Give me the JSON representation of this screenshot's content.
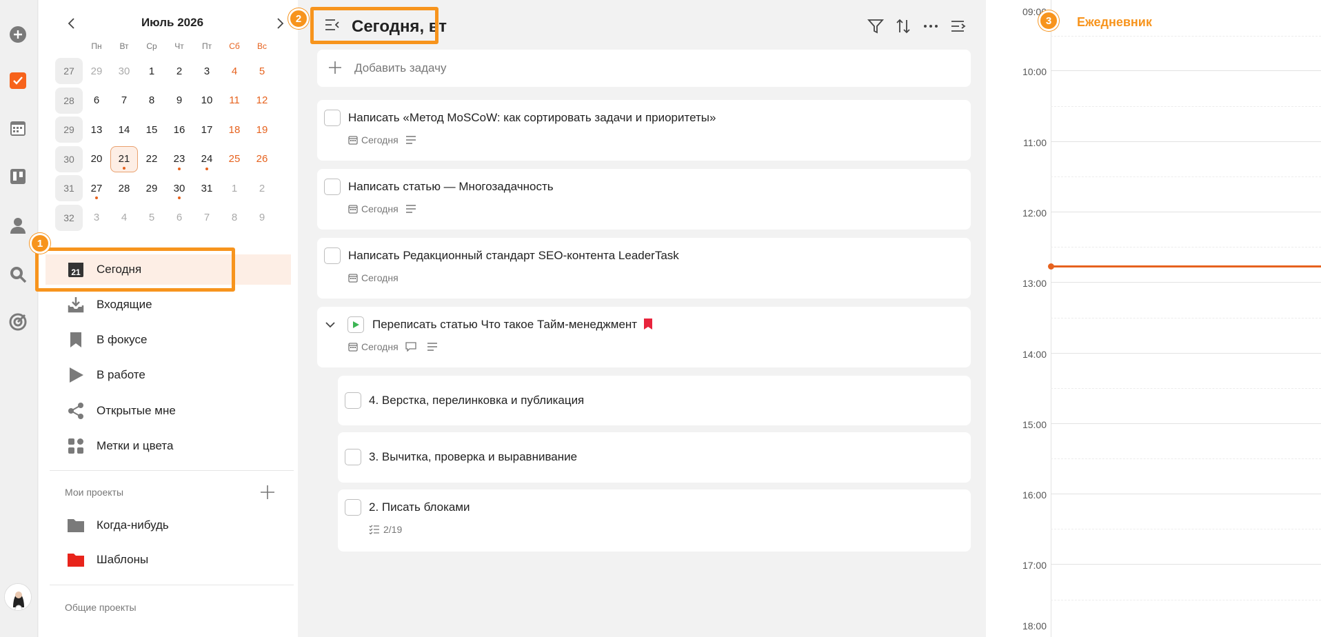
{
  "calendar": {
    "title": "Июль 2026",
    "dow": [
      "Пн",
      "Вт",
      "Ср",
      "Чт",
      "Пт",
      "Сб",
      "Вс"
    ],
    "weeks": [
      {
        "wk": "27",
        "days": [
          "29",
          "30",
          "1",
          "2",
          "3",
          "4",
          "5"
        ]
      },
      {
        "wk": "28",
        "days": [
          "6",
          "7",
          "8",
          "9",
          "10",
          "11",
          "12"
        ]
      },
      {
        "wk": "29",
        "days": [
          "13",
          "14",
          "15",
          "16",
          "17",
          "18",
          "19"
        ]
      },
      {
        "wk": "30",
        "days": [
          "20",
          "21",
          "22",
          "23",
          "24",
          "25",
          "26"
        ]
      },
      {
        "wk": "31",
        "days": [
          "27",
          "28",
          "29",
          "30",
          "31",
          "1",
          "2"
        ]
      },
      {
        "wk": "32",
        "days": [
          "3",
          "4",
          "5",
          "6",
          "7",
          "8",
          "9"
        ]
      }
    ]
  },
  "nav": {
    "today": "Сегодня",
    "today_icon_num": "21",
    "inbox": "Входящие",
    "focus": "В фокусе",
    "in_work": "В работе",
    "shared": "Открытые мне",
    "tags": "Метки и цвета"
  },
  "projects": {
    "my_label": "Мои проекты",
    "items": [
      "Когда-нибудь",
      "Шаблоны"
    ],
    "common_label": "Общие проекты"
  },
  "badges": {
    "one": "1",
    "two": "2",
    "three": "3"
  },
  "main": {
    "title": "Сегодня, вт",
    "add_task": "Добавить задачу",
    "tasks": [
      {
        "title": "Написать «Метод MoSCoW: как сортировать задачи и приоритеты»",
        "date": "Сегодня"
      },
      {
        "title": "Написать статью — Многозадачность",
        "date": "Сегодня"
      },
      {
        "title": "Написать Редакционный стандарт SEO-контента LeaderTask",
        "date": "Сегодня"
      },
      {
        "title": "Переписать статью Что такое Тайм-менеджмент",
        "date": "Сегодня"
      }
    ],
    "subtasks": [
      {
        "title": "4. Верстка, перелинковка и публикация"
      },
      {
        "title": "3. Вычитка, проверка и выравнивание"
      },
      {
        "title": "2. Писать блоками",
        "progress": "2/19"
      }
    ]
  },
  "timeline": {
    "title": "Ежедневник",
    "hours": [
      "09:00",
      "10:00",
      "11:00",
      "12:00",
      "13:00",
      "14:00",
      "15:00",
      "16:00",
      "17:00",
      "18:00"
    ]
  },
  "colors": {
    "accent": "#f7941d",
    "red": "#e6621e",
    "flag": "#e8243c",
    "play": "#3cb554"
  }
}
